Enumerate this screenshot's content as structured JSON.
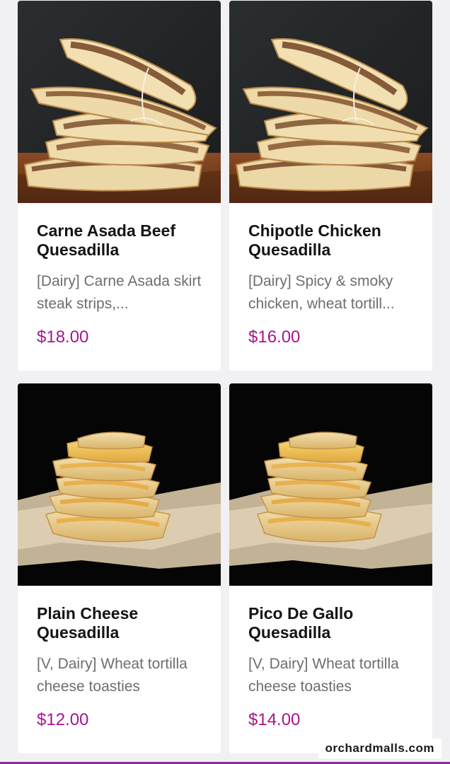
{
  "menu": {
    "items": [
      {
        "name": "Carne Asada Beef Quesadilla",
        "description": "[Dairy] Carne Asada skirt steak strips,...",
        "price": "$18.00",
        "image": "carne-asada-quesadilla-photo"
      },
      {
        "name": "Chipotle Chicken Quesadilla",
        "description": "[Dairy] Spicy & smoky chicken, wheat tortill...",
        "price": "$16.00",
        "image": "chipotle-chicken-quesadilla-photo"
      },
      {
        "name": "Plain Cheese Quesadilla",
        "description": "[V, Dairy] Wheat tortilla cheese toasties",
        "price": "$12.00",
        "image": "plain-cheese-quesadilla-photo"
      },
      {
        "name": "Pico De Gallo Quesadilla",
        "description": "[V, Dairy] Wheat tortilla cheese toasties",
        "price": "$14.00",
        "image": "pico-de-gallo-quesadilla-photo"
      }
    ]
  },
  "watermark": "orchardmalls.com",
  "colors": {
    "price": "#a8158f",
    "accent_line": "#8b2f9e",
    "background": "#f1f1f3"
  }
}
